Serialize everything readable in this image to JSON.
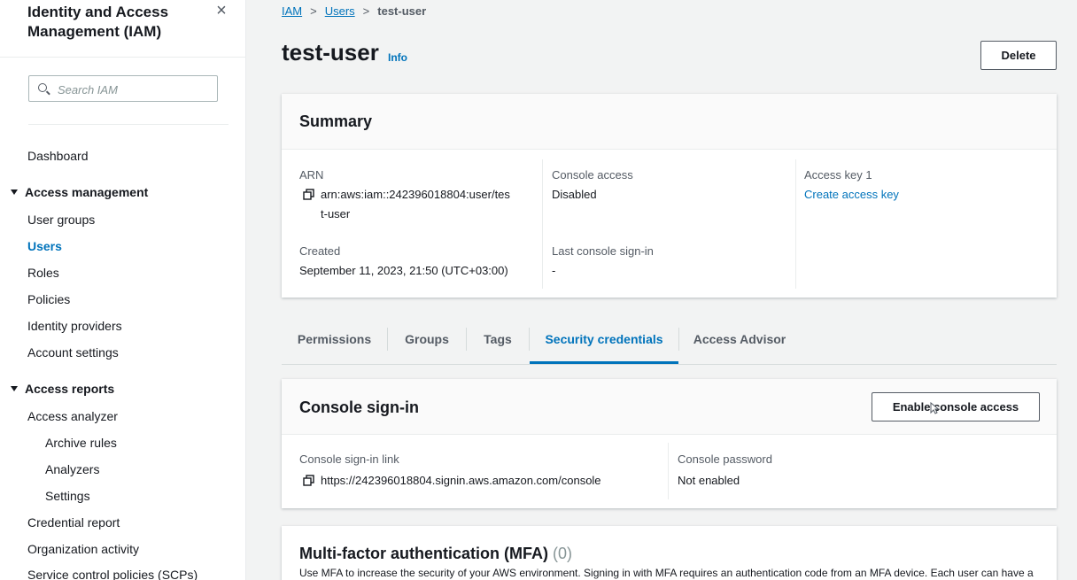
{
  "sidebar": {
    "title": "Identity and Access Management (IAM)",
    "search_placeholder": "Search IAM",
    "dashboard": "Dashboard",
    "access_management": {
      "label": "Access management",
      "items": [
        "User groups",
        "Users",
        "Roles",
        "Policies",
        "Identity providers",
        "Account settings"
      ],
      "active": "Users"
    },
    "access_reports": {
      "label": "Access reports",
      "items": [
        "Access analyzer",
        "Archive rules",
        "Analyzers",
        "Settings",
        "Credential report",
        "Organization activity",
        "Service control policies (SCPs)"
      ]
    }
  },
  "breadcrumb": {
    "iam": "IAM",
    "users": "Users",
    "current": "test-user"
  },
  "page": {
    "title": "test-user",
    "info": "Info",
    "delete_label": "Delete"
  },
  "summary": {
    "title": "Summary",
    "arn_label": "ARN",
    "arn_line1": "arn:aws:iam::242396018804:user/tes",
    "arn_line2": "t-user",
    "created_label": "Created",
    "created_value": "September 11, 2023, 21:50 (UTC+03:00)",
    "console_access_label": "Console access",
    "console_access_value": "Disabled",
    "last_signin_label": "Last console sign-in",
    "last_signin_value": "-",
    "access_key_label": "Access key 1",
    "access_key_link": "Create access key"
  },
  "tabs": [
    "Permissions",
    "Groups",
    "Tags",
    "Security credentials",
    "Access Advisor"
  ],
  "active_tab": "Security credentials",
  "console_signin": {
    "title": "Console sign-in",
    "enable_label": "Enable console access",
    "link_label": "Console sign-in link",
    "link_value": "https://242396018804.signin.aws.amazon.com/console",
    "password_label": "Console password",
    "password_value": "Not enabled"
  },
  "mfa": {
    "title": "Multi-factor authentication (MFA)",
    "count": "(0)",
    "description": "Use MFA to increase the security of your AWS environment. Signing in with MFA requires an authentication code from an MFA device. Each user can have a"
  },
  "colors": {
    "link": "#0073bb",
    "text": "#16191f",
    "muted": "#545b64",
    "background": "#f2f3f3"
  }
}
